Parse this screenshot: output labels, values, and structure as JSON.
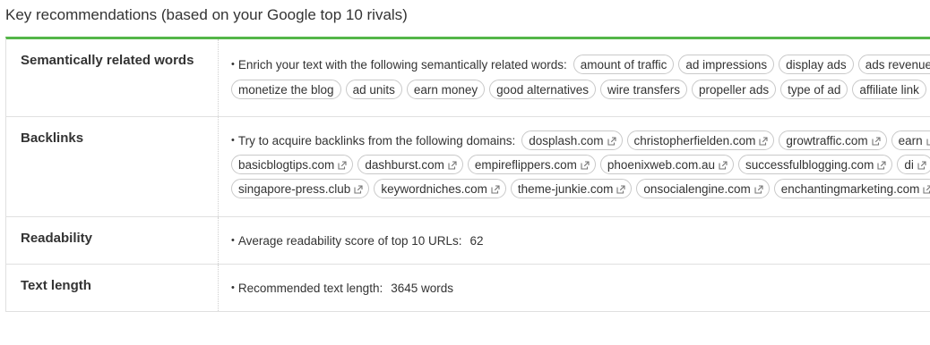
{
  "heading": "Key recommendations (based on your Google top 10 rivals)",
  "accent_color": "#54b648",
  "rows": {
    "semantic": {
      "label": "Semantically related words",
      "lead": "Enrich your text with the following semantically related words:",
      "line1": [
        "amount of traffic",
        "ad impressions",
        "display ads",
        "ads revenue"
      ],
      "line2": [
        "monetize the blog",
        "ad units",
        "earn money",
        "good alternatives",
        "wire transfers",
        "propeller ads",
        "type of ad",
        "affiliate link"
      ]
    },
    "backlinks": {
      "label": "Backlinks",
      "lead": "Try to acquire backlinks from the following domains:",
      "line1": [
        "dosplash.com",
        "christopherfielden.com",
        "growtraffic.com",
        "earn"
      ],
      "line2": [
        "basicblogtips.com",
        "dashburst.com",
        "empireflippers.com",
        "phoenixweb.com.au",
        "successfulblogging.com",
        "di"
      ],
      "line3": [
        "singapore-press.club",
        "keywordniches.com",
        "theme-junkie.com",
        "onsocialengine.com",
        "enchantingmarketing.com"
      ],
      "icon": "external-link-icon"
    },
    "readability": {
      "label": "Readability",
      "lead": "Average readability score of top 10 URLs:",
      "value": "62"
    },
    "text_length": {
      "label": "Text length",
      "lead": "Recommended text length:",
      "value": "3645 words"
    }
  }
}
